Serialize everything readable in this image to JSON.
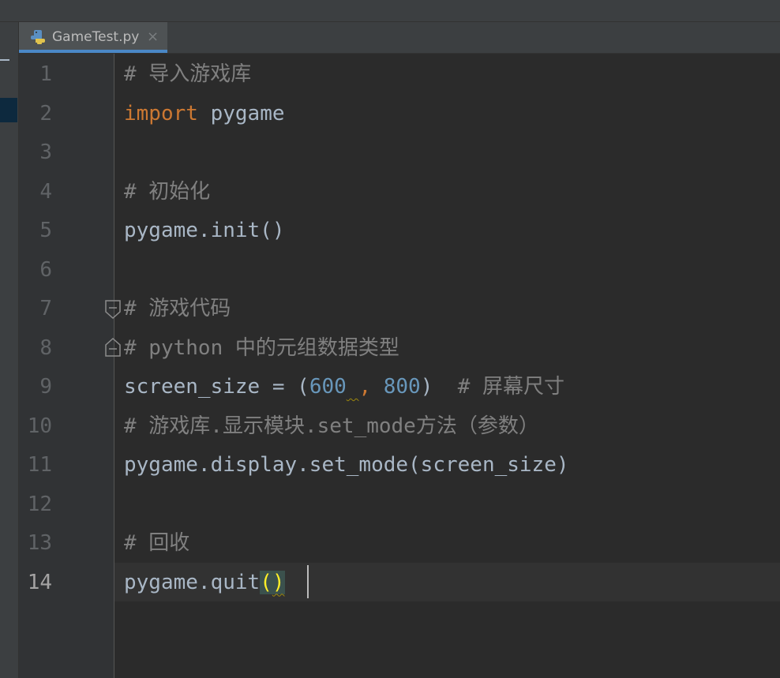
{
  "editor": {
    "tab": {
      "title": "GameTest.py",
      "close": "×",
      "icon": "python-file-icon"
    },
    "line_numbers": [
      "1",
      "2",
      "3",
      "4",
      "5",
      "6",
      "7",
      "8",
      "9",
      "10",
      "11",
      "12",
      "13",
      "14"
    ],
    "current_line": "14",
    "lines": [
      [
        {
          "t": "# 导入游戏库",
          "c": "cm"
        }
      ],
      [
        {
          "t": "import",
          "c": "kw"
        },
        {
          "t": " pygame",
          "c": ""
        }
      ],
      [],
      [
        {
          "t": "# 初始化",
          "c": "cm"
        }
      ],
      [
        {
          "t": "pygame.init()",
          "c": ""
        }
      ],
      [],
      [
        {
          "t": "# 游戏代码",
          "c": "cm"
        }
      ],
      [
        {
          "t": "# python 中的元组数据类型",
          "c": "cm"
        }
      ],
      [
        {
          "t": "screen_size = (",
          "c": ""
        },
        {
          "t": "600",
          "c": "nm"
        },
        {
          "t": " ",
          "c": "sq"
        },
        {
          "t": ",",
          "c": "kw"
        },
        {
          "t": " ",
          "c": ""
        },
        {
          "t": "800",
          "c": "nm"
        },
        {
          "t": ")  ",
          "c": ""
        },
        {
          "t": "# 屏幕尺寸",
          "c": "cm"
        }
      ],
      [
        {
          "t": "# 游戏库.显示模块.set_mode方法（参数）",
          "c": "cm"
        }
      ],
      [
        {
          "t": "pygame.display.set_mode(screen_size)",
          "c": ""
        }
      ],
      [],
      [
        {
          "t": "# 回收",
          "c": "cm"
        }
      ],
      [
        {
          "t": "pygame.quit",
          "c": ""
        },
        {
          "t": "(",
          "c": "br"
        },
        {
          "t": ")",
          "c": "br sq"
        }
      ]
    ],
    "colors": {
      "background": "#2b2b2b",
      "gutter": "#313335",
      "text": "#a9b7c6",
      "comment": "#808080",
      "keyword": "#cc7832",
      "number": "#6897bb",
      "brace_match": "#ffef28",
      "tab_underline": "#4a88c7"
    }
  }
}
